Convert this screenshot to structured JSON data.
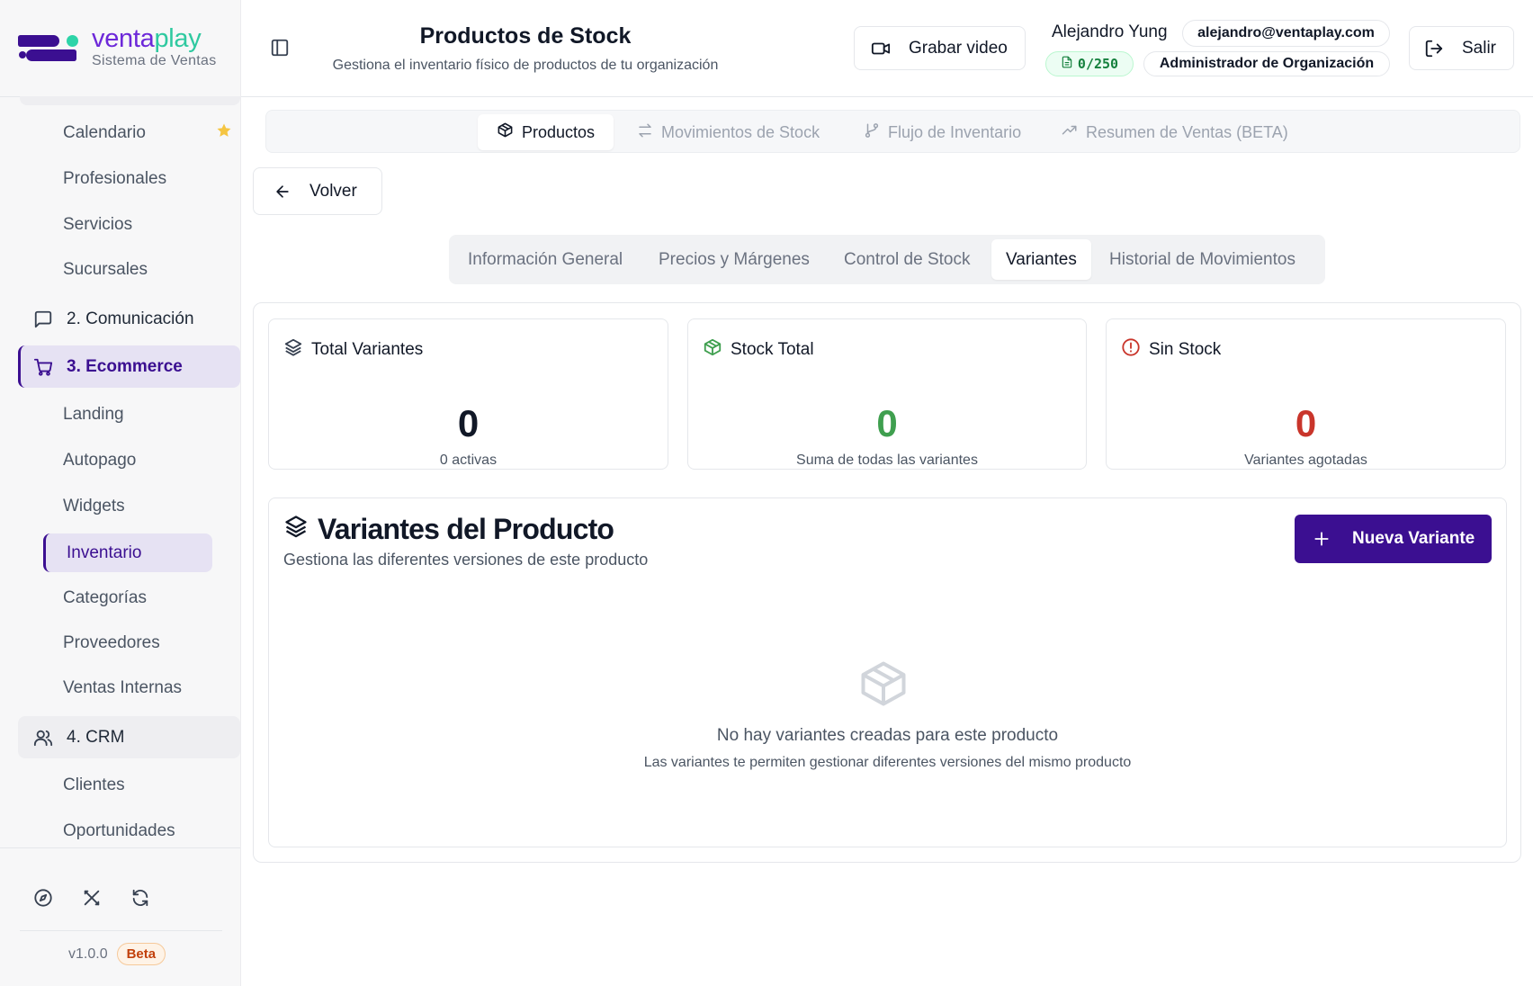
{
  "brand": {
    "name_part1": "venta",
    "name_part2": "play",
    "subtitle": "Sistema de Ventas"
  },
  "sidebar": {
    "items": [
      {
        "label": "Calendario"
      },
      {
        "label": "Profesionales"
      },
      {
        "label": "Servicios"
      },
      {
        "label": "Sucursales"
      }
    ],
    "section_comunicacion": "2. Comunicación",
    "section_ecommerce": "3. Ecommerce",
    "ecommerce_items": [
      {
        "label": "Landing"
      },
      {
        "label": "Autopago"
      },
      {
        "label": "Widgets"
      },
      {
        "label": "Inventario"
      },
      {
        "label": "Categorías"
      },
      {
        "label": "Proveedores"
      },
      {
        "label": "Ventas Internas"
      }
    ],
    "section_crm": "4. CRM",
    "crm_items": [
      {
        "label": "Clientes"
      },
      {
        "label": "Oportunidades"
      }
    ],
    "version": "v1.0.0",
    "badge": "Beta"
  },
  "header": {
    "title": "Productos de Stock",
    "subtitle": "Gestiona el inventario físico de productos de tu organización",
    "record_label": "Grabar video",
    "user_name": "Alejandro Yung",
    "user_email": "alejandro@ventaplay.com",
    "quota": "0/250",
    "role": "Administrador de Organización",
    "exit_label": "Salir"
  },
  "main_tabs": [
    {
      "label": "Productos",
      "icon": "package-icon",
      "active": true
    },
    {
      "label": "Movimientos de Stock",
      "icon": "arrows-icon"
    },
    {
      "label": "Flujo de Inventario",
      "icon": "git-branch-icon"
    },
    {
      "label": "Resumen de Ventas (BETA)",
      "icon": "trending-up-icon"
    }
  ],
  "back_label": "Volver",
  "sub_tabs": [
    {
      "label": "Información General"
    },
    {
      "label": "Precios y Márgenes"
    },
    {
      "label": "Control de Stock"
    },
    {
      "label": "Variantes",
      "active": true
    },
    {
      "label": "Historial de Movimientos"
    }
  ],
  "stats": [
    {
      "title": "Total Variantes",
      "value": "0",
      "note": "0 activas",
      "color": "#111827",
      "icon": "layers-icon"
    },
    {
      "title": "Stock Total",
      "value": "0",
      "note": "Suma de todas las variantes",
      "color": "#3f9f4f",
      "icon": "package-icon"
    },
    {
      "title": "Sin Stock",
      "value": "0",
      "note": "Variantes agotadas",
      "color": "#c9352b",
      "icon": "alert-circle-icon"
    }
  ],
  "variants": {
    "title": "Variantes del Producto",
    "subtitle": "Gestiona las diferentes versiones de este producto",
    "new_label": "Nueva Variante",
    "empty_title": "No hay variantes creadas para este producto",
    "empty_sub": "Las variantes te permiten gestionar diferentes versiones del mismo producto"
  },
  "colors": {
    "brand": "#3b0f91",
    "accent": "#2fc9a0",
    "active_bg": "#e6e2f3"
  }
}
